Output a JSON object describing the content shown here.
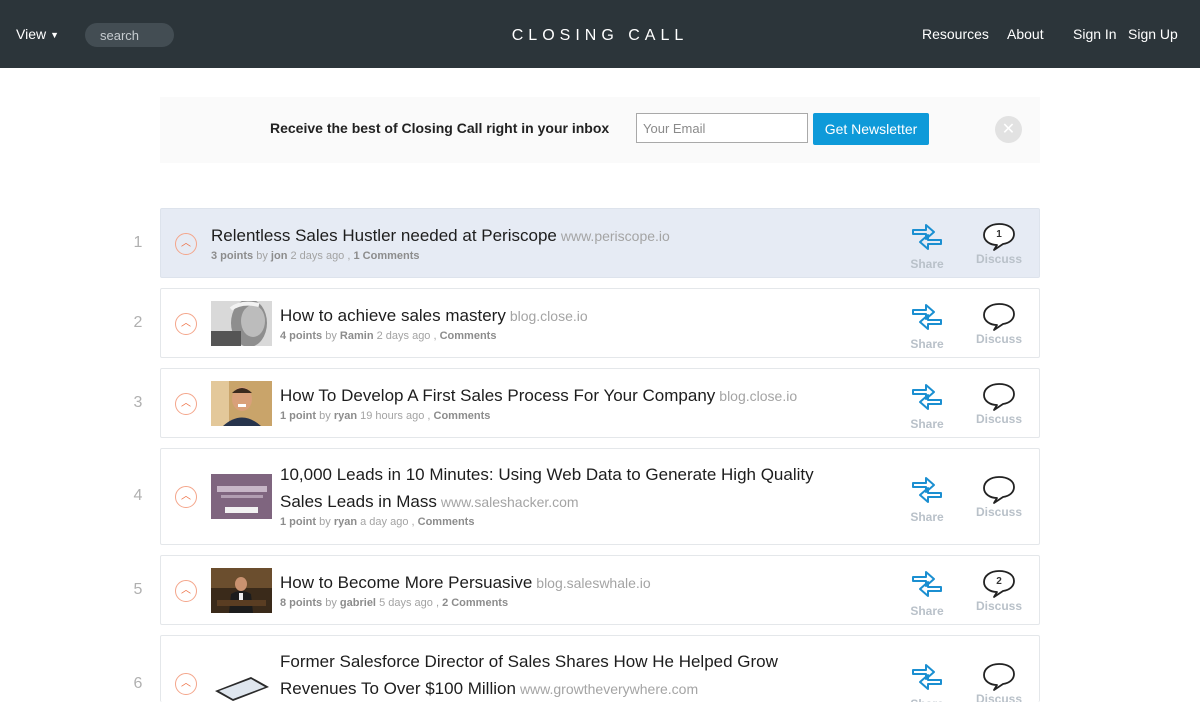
{
  "header": {
    "view_label": "View",
    "search_placeholder": "search",
    "logo": "CLOSING CALL",
    "resources": "Resources",
    "about": "About",
    "sign_in": "Sign In",
    "sign_up": "Sign Up"
  },
  "newsletter": {
    "text": "Receive the best of Closing Call right in your inbox",
    "email_placeholder": "Your Email",
    "button": "Get Newsletter"
  },
  "actions": {
    "share": "Share",
    "discuss": "Discuss"
  },
  "posts": [
    {
      "rank": "1",
      "title": "Relentless Sales Hustler needed at Periscope",
      "domain": "www.periscope.io",
      "points": "3 points",
      "by": "by",
      "author": "jon",
      "time": "2 days ago",
      "comments": "1 Comments",
      "comment_count": "1",
      "thumbnail": "none",
      "highlighted": true
    },
    {
      "rank": "2",
      "title": "How to achieve sales mastery",
      "domain": "blog.close.io",
      "points": "4 points",
      "by": "by",
      "author": "Ramin",
      "time": "2 days ago",
      "comments": "Comments",
      "comment_count": "",
      "thumbnail": "bw-portrait"
    },
    {
      "rank": "3",
      "title": "How To Develop A First Sales Process For Your Company",
      "domain": "blog.close.io",
      "points": "1 point",
      "by": "by",
      "author": "ryan",
      "time": "19 hours ago",
      "comments": "Comments",
      "comment_count": "",
      "thumbnail": "smiling-man"
    },
    {
      "rank": "4",
      "title": "10,000 Leads in 10 Minutes: Using Web Data to Generate High Quality Sales Leads in Mass",
      "domain": "www.saleshacker.com",
      "points": "1 point",
      "by": "by",
      "author": "ryan",
      "time": "a day ago",
      "comments": "Comments",
      "comment_count": "",
      "thumbnail": "conference-banner"
    },
    {
      "rank": "5",
      "title": "How to Become More Persuasive",
      "domain": "blog.saleswhale.io",
      "points": "8 points",
      "by": "by",
      "author": "gabriel",
      "time": "5 days ago",
      "comments": "2 Comments",
      "comment_count": "2",
      "thumbnail": "man-in-office"
    },
    {
      "rank": "6",
      "title": "Former Salesforce Director of Sales Shares How He Helped Grow Revenues To Over $100 Million",
      "domain": "www.growtheverywhere.com",
      "points": "",
      "by": "",
      "author": "",
      "time": "",
      "comments": "",
      "comment_count": "",
      "thumbnail": "smartphone"
    }
  ],
  "colors": {
    "header_bg": "#2c353a",
    "accent": "#0e9ad9",
    "upvote": "#ee6a3c",
    "highlight_row": "#e6ebf4"
  }
}
